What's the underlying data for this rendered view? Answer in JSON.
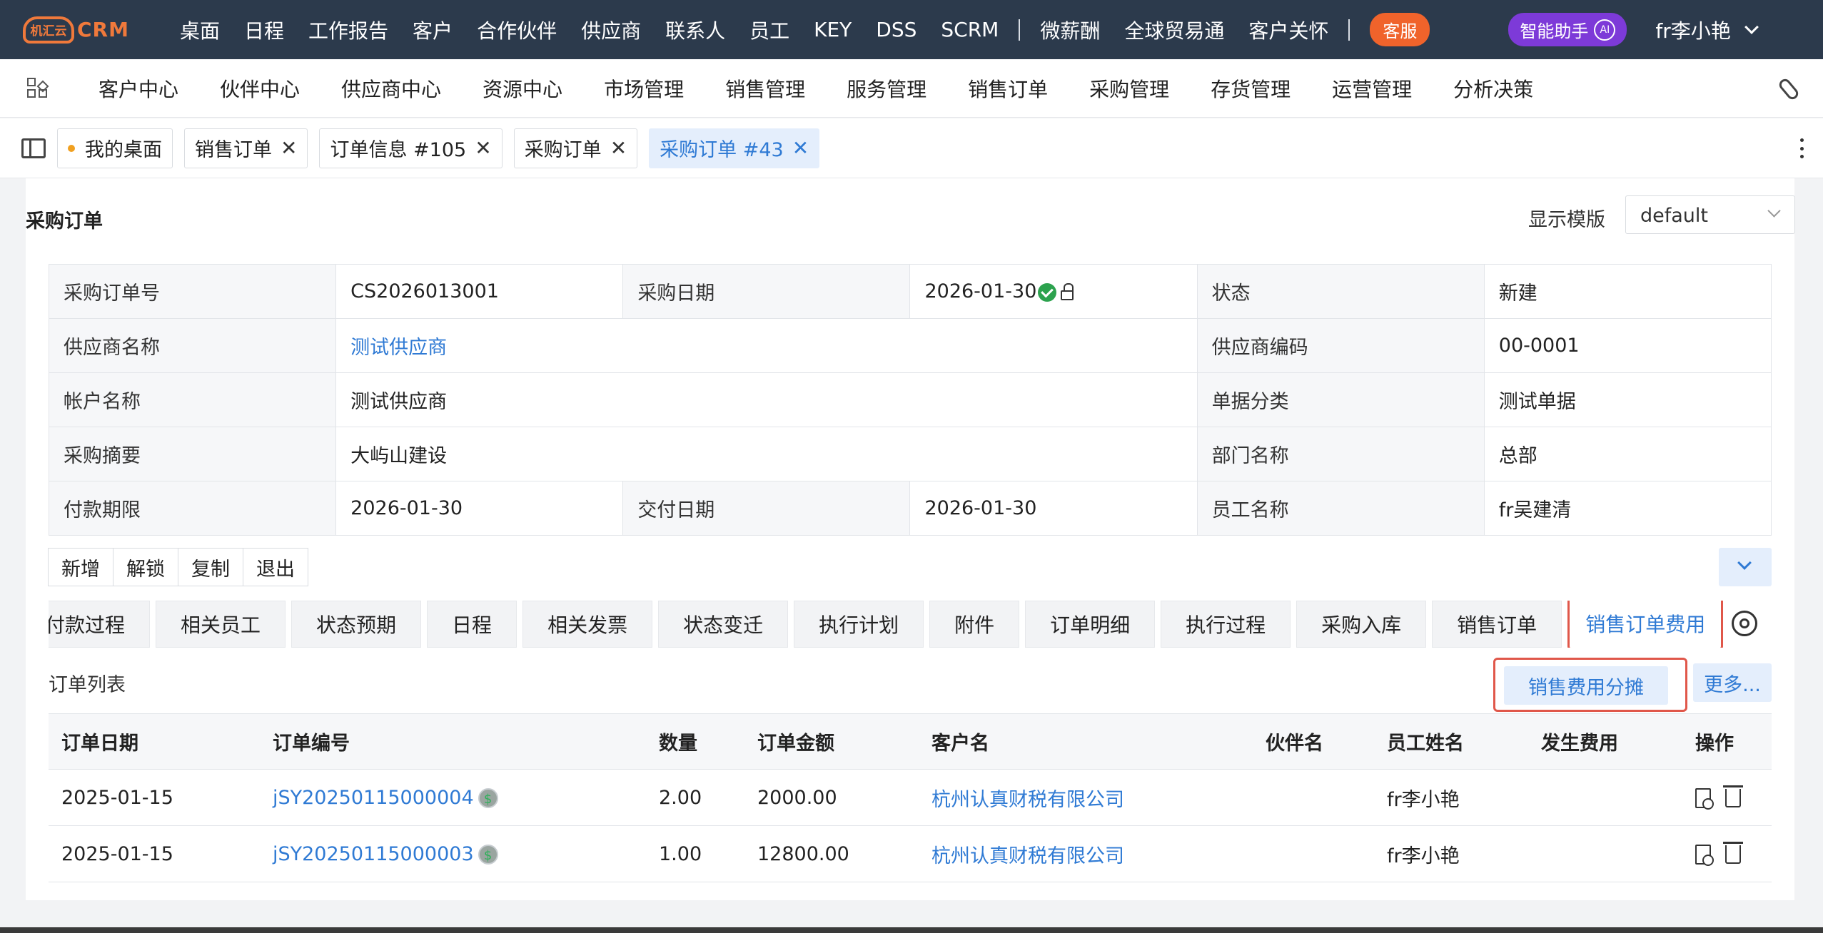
{
  "topbar": {
    "logo_cn": "机汇云",
    "logo_crm": "CRM",
    "nav": [
      "桌面",
      "日程",
      "工作报告",
      "客户",
      "合作伙伴",
      "供应商",
      "联系人",
      "员工",
      "KEY",
      "DSS",
      "SCRM"
    ],
    "nav2": [
      "微薪酬",
      "全球贸易通",
      "客户关怀"
    ],
    "kefu": "客服",
    "ai_label": "智能助手",
    "ai_badge": "AI",
    "user": "fr李小艳"
  },
  "modnav": [
    "客户中心",
    "伙伴中心",
    "供应商中心",
    "资源中心",
    "市场管理",
    "销售管理",
    "服务管理",
    "销售订单",
    "采购管理",
    "存货管理",
    "运营管理",
    "分析决策"
  ],
  "tabs": [
    {
      "label": "我的桌面",
      "closable": false,
      "active": false
    },
    {
      "label": "销售订单",
      "closable": true,
      "active": false
    },
    {
      "label": "订单信息 #105",
      "closable": true,
      "active": false
    },
    {
      "label": "采购订单",
      "closable": true,
      "active": false
    },
    {
      "label": "采购订单 #43",
      "closable": true,
      "active": true
    }
  ],
  "card": {
    "title": "采购订单",
    "template_label": "显示模版",
    "template_value": "default"
  },
  "info": {
    "order_no_label": "采购订单号",
    "order_no": "CS2026013001",
    "date_label": "采购日期",
    "date": "2026-01-30",
    "status_label": "状态",
    "status": "新建",
    "supplier_label": "供应商名称",
    "supplier": "测试供应商",
    "supplier_code_label": "供应商编码",
    "supplier_code": "00-0001",
    "account_label": "帐户名称",
    "account": "测试供应商",
    "category_label": "单据分类",
    "category": "测试单据",
    "summary_label": "采购摘要",
    "summary": "大屿山建设",
    "dept_label": "部门名称",
    "dept": "总部",
    "payment_label": "付款期限",
    "payment": "2026-01-30",
    "delivery_label": "交付日期",
    "delivery": "2026-01-30",
    "employee_label": "员工名称",
    "employee": "fr吴建清"
  },
  "actions": [
    "新增",
    "解锁",
    "复制",
    "退出"
  ],
  "subtabs": [
    "付款过程",
    "相关员工",
    "状态预期",
    "日程",
    "相关发票",
    "状态变迁",
    "执行计划",
    "附件",
    "订单明细",
    "执行过程",
    "采购入库",
    "销售订单",
    "销售订单费用"
  ],
  "list": {
    "title": "订单列表",
    "alloc_button": "销售费用分摊",
    "more_button": "更多...",
    "columns": [
      "订单日期",
      "订单编号",
      "数量",
      "订单金额",
      "客户名",
      "伙伴名",
      "员工姓名",
      "发生费用",
      "操作"
    ],
    "rows": [
      {
        "date": "2025-01-15",
        "no": "jSY20250115000004",
        "qty": "2.00",
        "amount": "2000.00",
        "customer": "杭州认真财税有限公司",
        "partner": "",
        "employee": "fr李小艳",
        "cost": ""
      },
      {
        "date": "2025-01-15",
        "no": "jSY20250115000003",
        "qty": "1.00",
        "amount": "12800.00",
        "customer": "杭州认真财税有限公司",
        "partner": "",
        "employee": "fr李小艳",
        "cost": ""
      }
    ],
    "coin_symbol": "$"
  },
  "colors": {
    "accent": "#2f7ad4",
    "topbar": "#2c3a4c",
    "highlight": "#e0574a",
    "kefu": "#f0632b",
    "ai": "#7d3ad8"
  }
}
